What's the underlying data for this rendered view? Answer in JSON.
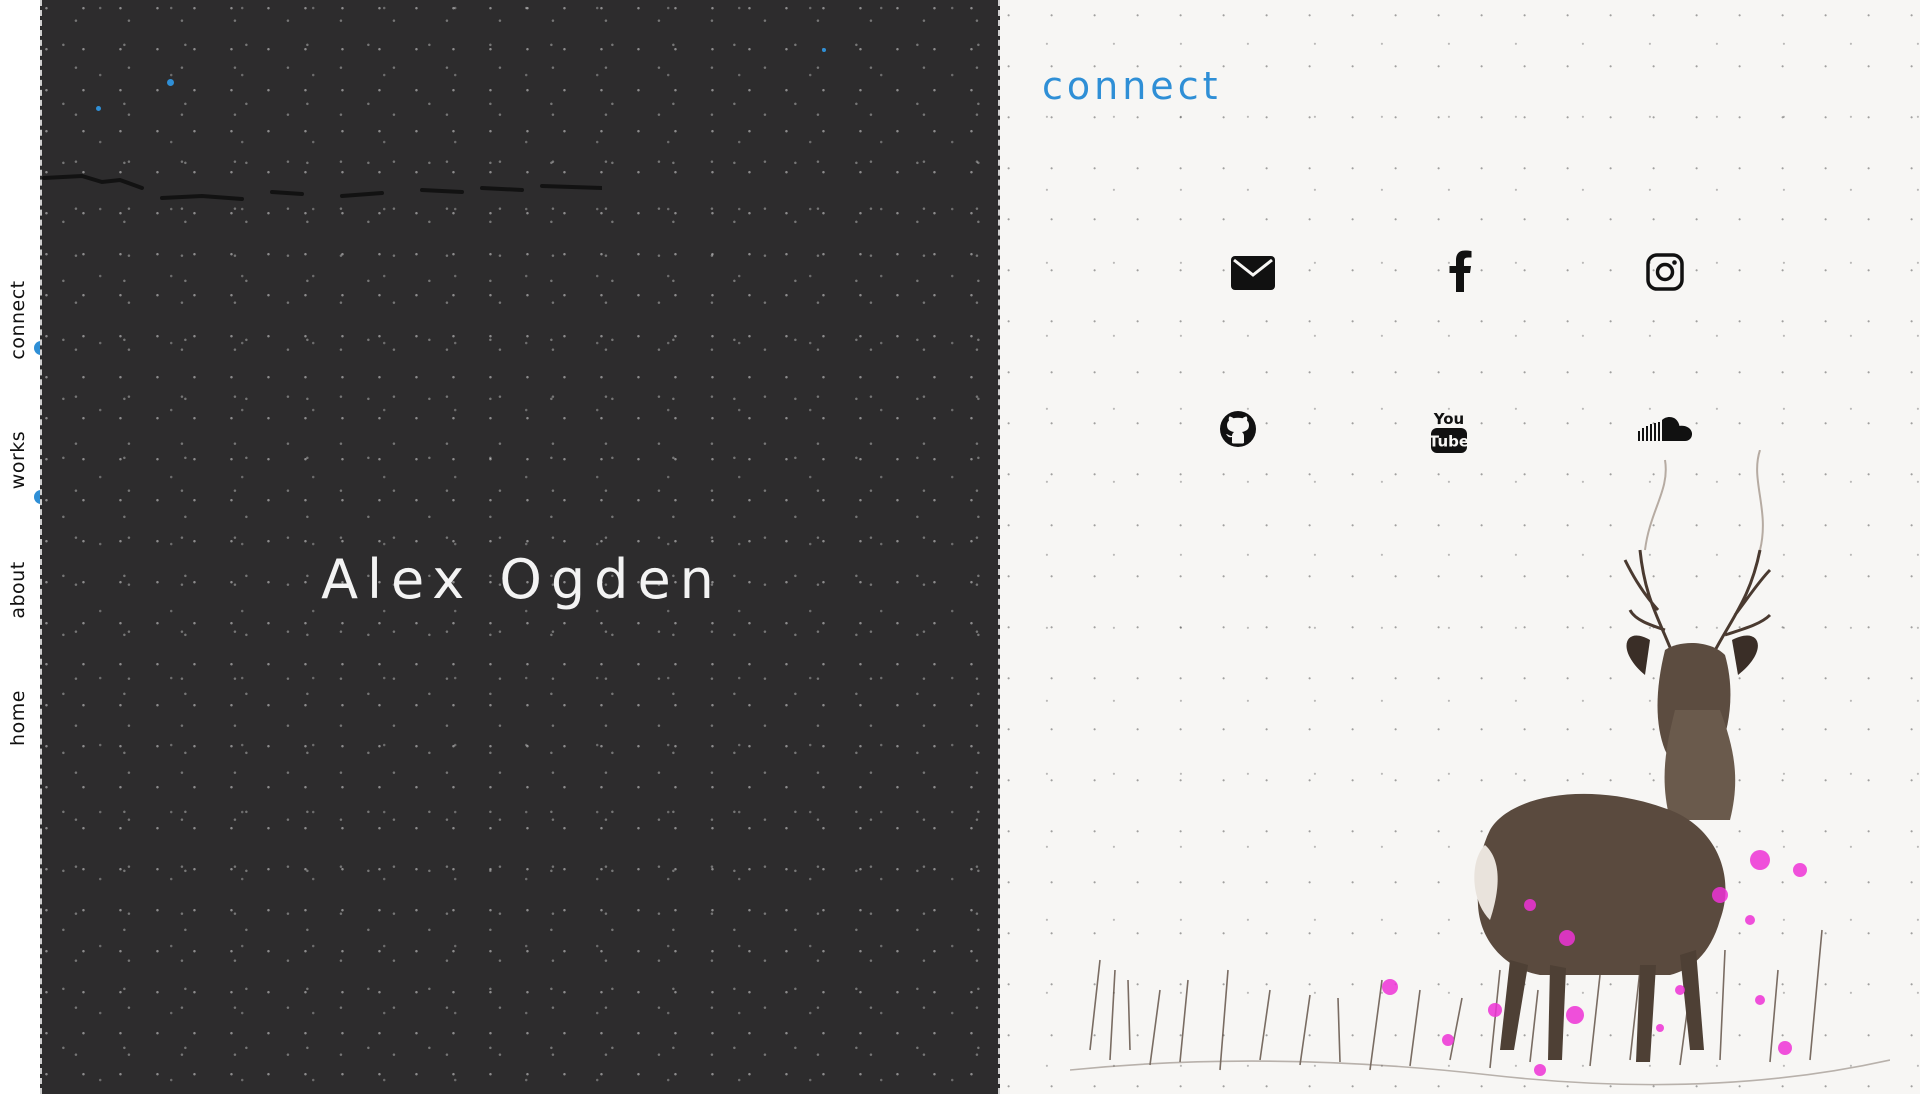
{
  "nav": {
    "items": [
      {
        "label": "connect"
      },
      {
        "label": "works"
      },
      {
        "label": "about"
      },
      {
        "label": "home"
      }
    ]
  },
  "hero": {
    "name": "Alex Ogden"
  },
  "connect": {
    "title": "connect",
    "links": [
      {
        "icon": "envelope-icon",
        "label": "email"
      },
      {
        "icon": "facebook-icon",
        "label": "facebook"
      },
      {
        "icon": "instagram-icon",
        "label": "instagram"
      },
      {
        "icon": "github-icon",
        "label": "github"
      },
      {
        "icon": "youtube-icon",
        "label": "youtube",
        "logo_text_top": "You",
        "logo_text_bottom": "Tube"
      },
      {
        "icon": "soundcloud-icon",
        "label": "soundcloud"
      }
    ]
  },
  "colors": {
    "accent": "#2f8fd6",
    "hero_bg": "#2d2c2d",
    "panel_bg": "#f7f6f4",
    "paint_splash": "#ee33d6"
  }
}
